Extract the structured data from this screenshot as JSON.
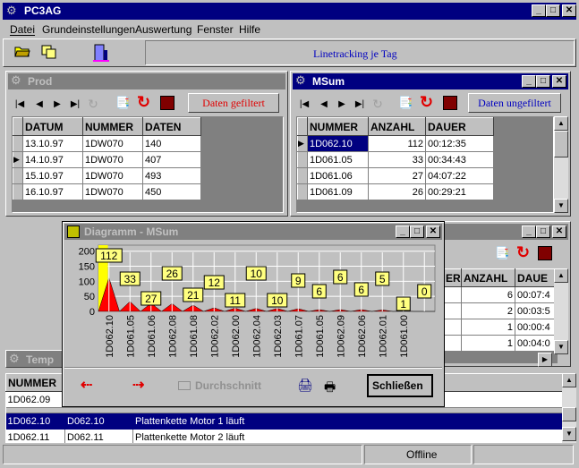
{
  "app": {
    "title": "PC3AG"
  },
  "menu": [
    "Datei",
    "Grundeinstellungen",
    "Auswertung",
    "Fenster",
    "Hilfe"
  ],
  "toolbar": {
    "caption": "Linetracking je Tag"
  },
  "prod": {
    "title": "Prod",
    "filter_label": "Daten gefiltert",
    "columns": [
      "DATUM",
      "NUMMER",
      "DATEN"
    ],
    "rows": [
      [
        "13.10.97",
        "1DW070",
        "140"
      ],
      [
        "14.10.97",
        "1DW070",
        "407"
      ],
      [
        "15.10.97",
        "1DW070",
        "493"
      ],
      [
        "16.10.97",
        "1DW070",
        "450"
      ]
    ],
    "current_row": 1
  },
  "msum": {
    "title": "MSum",
    "filter_label": "Daten ungefiltert",
    "columns": [
      "NUMMER",
      "ANZAHL",
      "DAUER"
    ],
    "rows": [
      [
        "1D062.10",
        "112",
        "00:12:35"
      ],
      [
        "1D061.05",
        "33",
        "00:34:43"
      ],
      [
        "1D061.06",
        "27",
        "04:07:22"
      ],
      [
        "1D061.09",
        "26",
        "00:29:21"
      ]
    ],
    "current_row": 0
  },
  "second": {
    "columns": [
      "ER",
      "ANZAHL",
      "DAUE"
    ],
    "rows": [
      [
        "6",
        "00:07:4"
      ],
      [
        "2",
        "00:03:5"
      ],
      [
        "1",
        "00:00:4"
      ],
      [
        "1",
        "00:04:0"
      ]
    ]
  },
  "temp": {
    "title": "Temp",
    "columns": [
      "NUMMER"
    ],
    "rows": [
      [
        "1D062.09",
        "",
        ""
      ],
      [
        "1D062.10",
        "D062.10",
        "Plattenkette Motor 1 läuft"
      ],
      [
        "1D062.11",
        "D062.11",
        "Plattenkette Motor 2 läuft"
      ]
    ],
    "selected_row": 1
  },
  "diagram": {
    "title": "Diagramm - MSum",
    "average_label": "Durchschnitt",
    "close_label": "Schließen"
  },
  "status": {
    "mode": "Offline"
  },
  "colors": {
    "titlebar": "#000080",
    "bar": "#ff0000",
    "highlight": "#ffff00",
    "chart_bg": "#c0c0c0"
  },
  "chart_data": {
    "type": "area",
    "categories": [
      "1D062.10",
      "1D061.05",
      "1D061.06",
      "1D062.08",
      "1D061.08",
      "1D062.02",
      "1D062.00",
      "1D062.04",
      "1D062.03",
      "1D061.07",
      "1D061.05",
      "1D062.09",
      "1D062.06",
      "1D062.01",
      "1D061.00"
    ],
    "values": [
      112,
      33,
      27,
      26,
      21,
      12,
      11,
      10,
      10,
      9,
      6,
      6,
      6,
      5,
      1,
      0
    ],
    "labels": [
      112,
      33,
      27,
      26,
      21,
      12,
      11,
      10,
      10,
      9,
      6,
      6,
      6,
      5,
      1,
      0
    ],
    "yticks": [
      0,
      50,
      100,
      150,
      200
    ],
    "ylim": [
      0,
      220
    ]
  }
}
